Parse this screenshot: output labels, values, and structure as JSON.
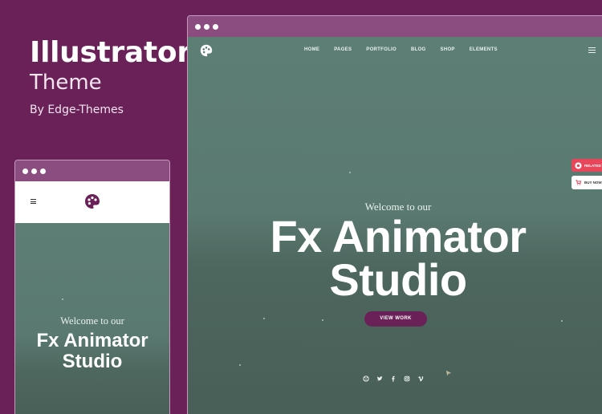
{
  "promo": {
    "title": "Illustrator",
    "subtitle": "Theme",
    "byline": "By Edge-Themes"
  },
  "desktop": {
    "nav": [
      "HOME",
      "PAGES",
      "PORTFOLIO",
      "BLOG",
      "SHOP",
      "ELEMENTS"
    ],
    "hero": {
      "welcome": "Welcome to our",
      "title_line1": "Fx Animator",
      "title_line2": "Studio",
      "button": "VIEW WORK"
    },
    "side": {
      "related": "RELATED",
      "buy_now": "BUY NOW"
    },
    "socials": [
      "dribbble-icon",
      "twitter-icon",
      "facebook-icon",
      "instagram-icon",
      "vimeo-icon"
    ]
  },
  "mobile": {
    "hero": {
      "welcome": "Welcome to our",
      "title_line1": "Fx Animator",
      "title_line2": "Studio"
    }
  },
  "colors": {
    "brand": "#6a2158",
    "window_bar": "#8b4d80",
    "hero_bg": "#5a7a71",
    "related": "#e8465b"
  }
}
